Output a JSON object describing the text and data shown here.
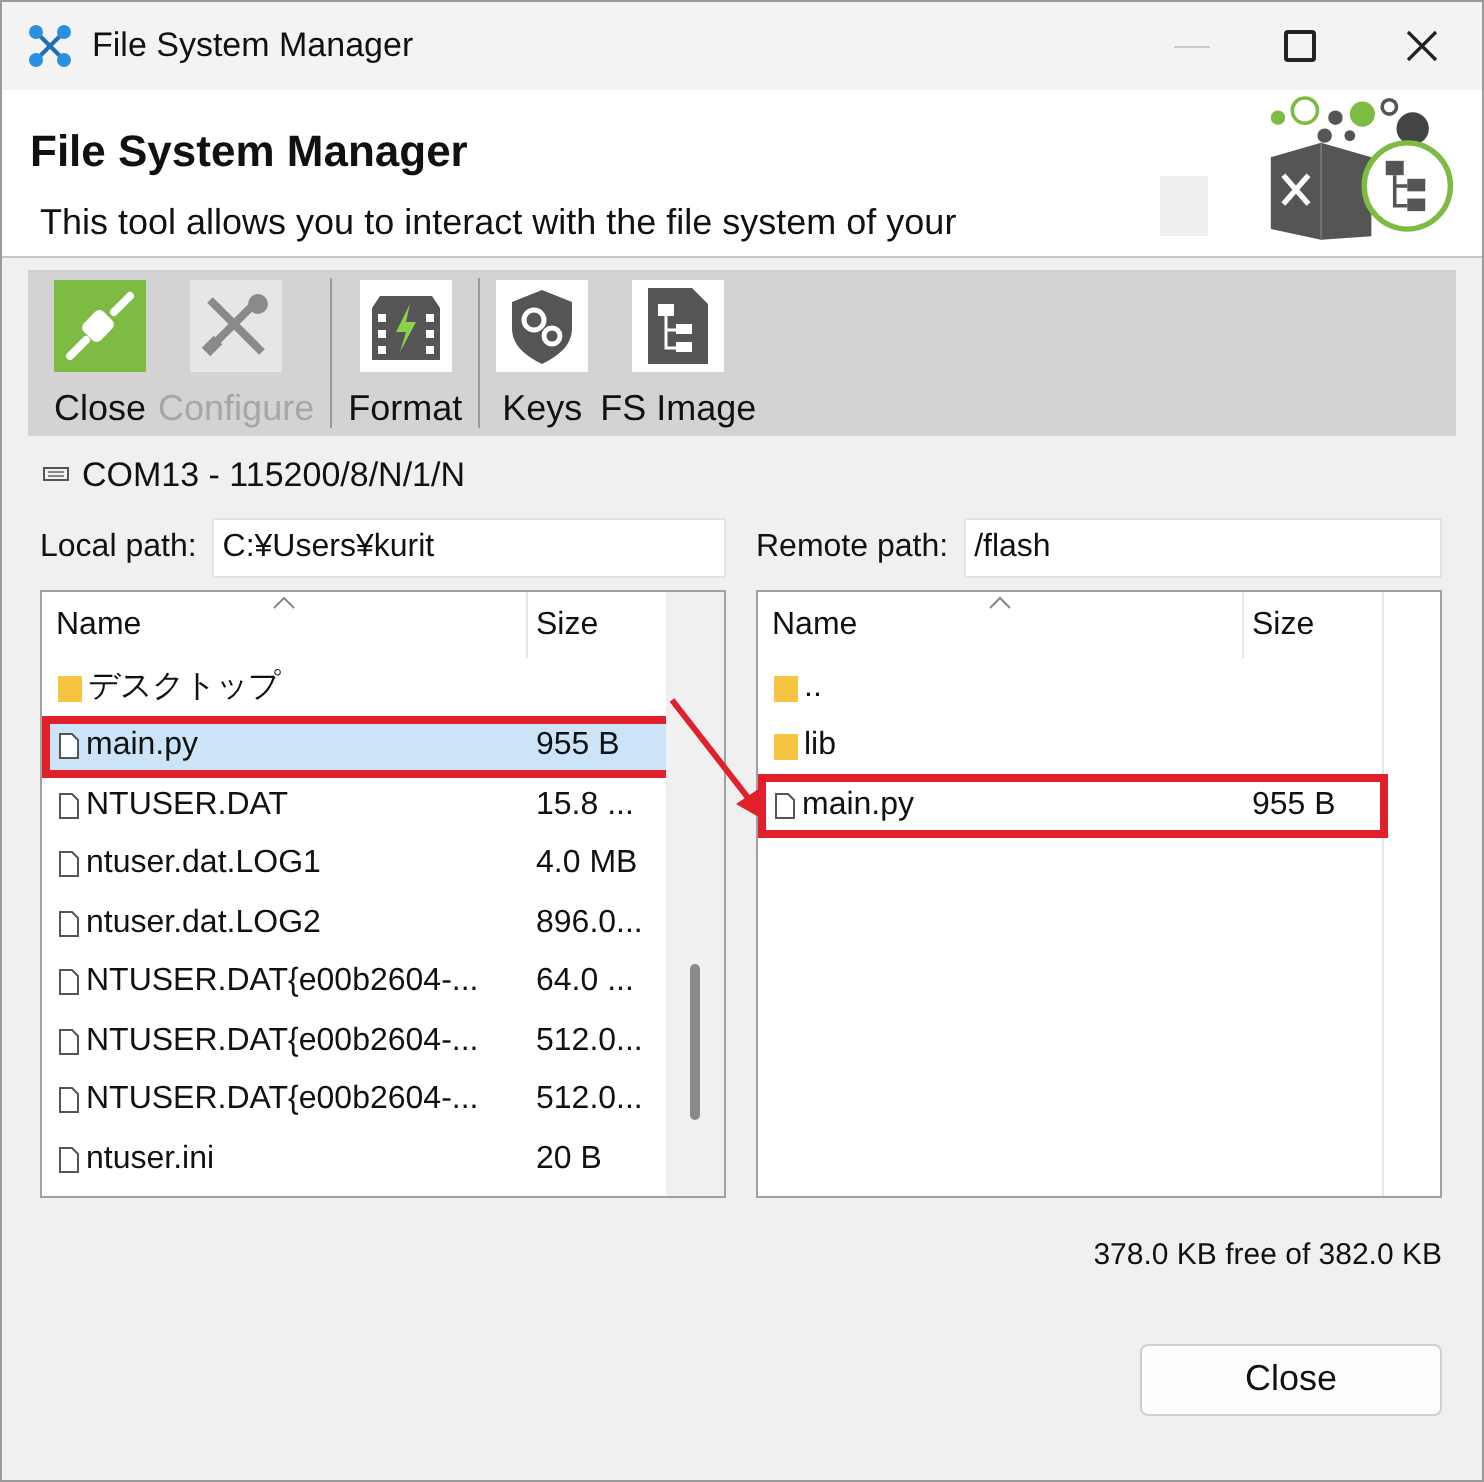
{
  "window": {
    "title": "File System Manager"
  },
  "header": {
    "title": "File System Manager",
    "description": "This tool allows you to interact with the file system of your"
  },
  "toolbar": {
    "groups": [
      [
        {
          "label": "Close",
          "disabled": false
        },
        {
          "label": "Configure",
          "disabled": true
        }
      ],
      [
        {
          "label": "Format",
          "disabled": false
        }
      ],
      [
        {
          "label": "Keys",
          "disabled": false
        },
        {
          "label": "FS Image",
          "disabled": false
        }
      ]
    ]
  },
  "connection": "COM13 - 115200/8/N/1/N",
  "panes": [
    {
      "path_label": "Local path:",
      "path": "C:¥Users¥kurit",
      "columns": [
        "Name",
        "Size"
      ],
      "scrollbar": true,
      "rows": [
        {
          "kind": "folder",
          "name": "デスクトップ",
          "size": "",
          "selected": false,
          "highlighted": false
        },
        {
          "kind": "file",
          "name": "main.py",
          "size": "955 B",
          "selected": true,
          "highlighted": true
        },
        {
          "kind": "file",
          "name": "NTUSER.DAT",
          "size": "15.8 ...",
          "selected": false,
          "highlighted": false
        },
        {
          "kind": "file",
          "name": "ntuser.dat.LOG1",
          "size": "4.0 MB",
          "selected": false,
          "highlighted": false
        },
        {
          "kind": "file",
          "name": "ntuser.dat.LOG2",
          "size": "896.0...",
          "selected": false,
          "highlighted": false
        },
        {
          "kind": "file",
          "name": "NTUSER.DAT{e00b2604-...",
          "size": "64.0 ...",
          "selected": false,
          "highlighted": false
        },
        {
          "kind": "file",
          "name": "NTUSER.DAT{e00b2604-...",
          "size": "512.0...",
          "selected": false,
          "highlighted": false
        },
        {
          "kind": "file",
          "name": "NTUSER.DAT{e00b2604-...",
          "size": "512.0...",
          "selected": false,
          "highlighted": false
        },
        {
          "kind": "file",
          "name": "ntuser.ini",
          "size": "20 B",
          "selected": false,
          "highlighted": false
        }
      ]
    },
    {
      "path_label": "Remote path:",
      "path": "/flash",
      "columns": [
        "Name",
        "Size"
      ],
      "scrollbar": false,
      "rows": [
        {
          "kind": "folder",
          "name": "..",
          "size": "",
          "selected": false,
          "highlighted": false
        },
        {
          "kind": "folder",
          "name": "lib",
          "size": "",
          "selected": false,
          "highlighted": false
        },
        {
          "kind": "file",
          "name": "main.py",
          "size": "955 B",
          "selected": false,
          "highlighted": true
        }
      ]
    }
  ],
  "free_space": "378.0 KB free of 382.0 KB",
  "buttons": [
    "Close"
  ]
}
